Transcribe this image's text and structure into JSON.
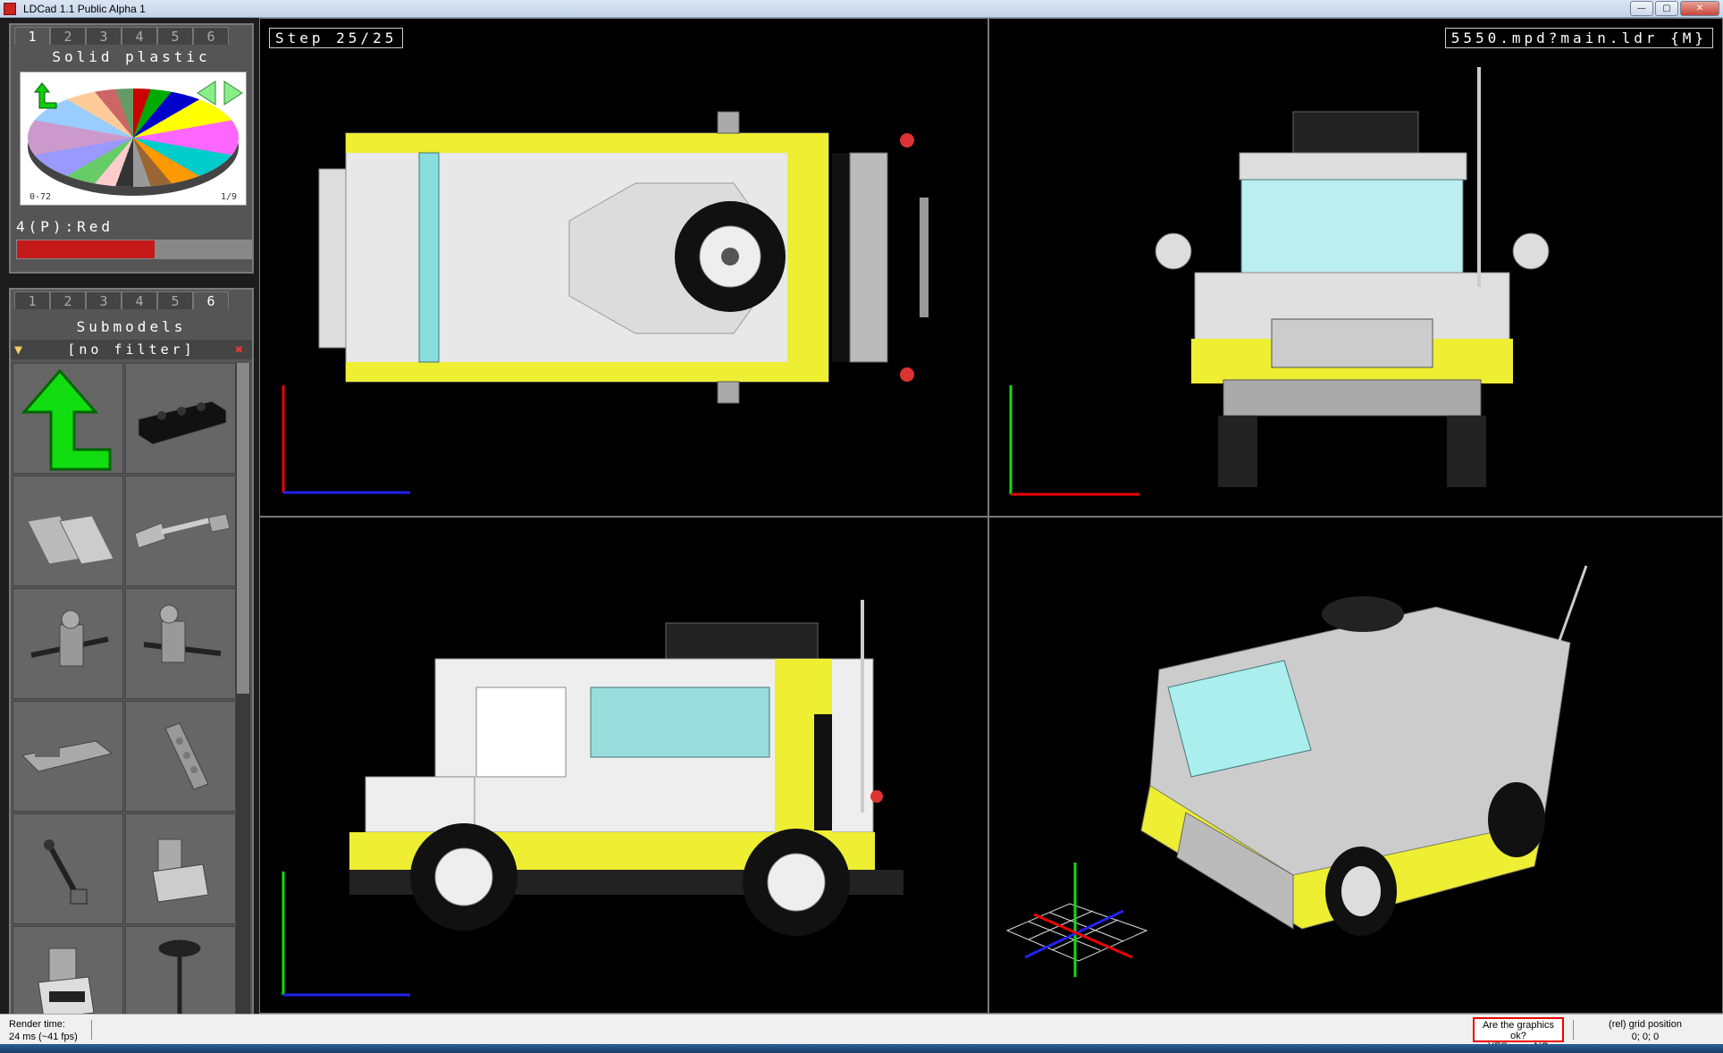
{
  "window": {
    "title": "LDCad 1.1 Public Alpha 1"
  },
  "colors": {
    "accent_red": "#ee0000",
    "panel_bg": "#555555",
    "viewport_bg": "#000000"
  },
  "palette_panel": {
    "tabs": [
      "1",
      "2",
      "3",
      "4",
      "5",
      "6"
    ],
    "active_tab": "1",
    "title": "Solid plastic",
    "range_label": "0-72",
    "page_label": "1/9",
    "current_color": "4(P):Red"
  },
  "submodels_panel": {
    "tabs": [
      "1",
      "2",
      "3",
      "4",
      "5",
      "6"
    ],
    "active_tab": "6",
    "title": "Submodels",
    "filter": "[no filter]",
    "items": [
      {
        "icon": "up-arrow-icon"
      },
      {
        "icon": "black-brick-icon"
      },
      {
        "icon": "plate-pair-icon"
      },
      {
        "icon": "bar-clip-icon"
      },
      {
        "icon": "axle-assembly-icon"
      },
      {
        "icon": "axle-joint-icon"
      },
      {
        "icon": "chassis-part-icon"
      },
      {
        "icon": "long-brick-icon"
      },
      {
        "icon": "steering-rod-icon"
      },
      {
        "icon": "seat-assembly-icon"
      },
      {
        "icon": "engine-block-icon"
      },
      {
        "icon": "wheel-stand-icon"
      }
    ]
  },
  "viewports": {
    "top_left": {
      "hud": "Step 25/25",
      "view": "top"
    },
    "top_right": {
      "hud": "5550.mpd?main.ldr {M}",
      "view": "front"
    },
    "bottom_left": {
      "view": "side"
    },
    "bottom_right": {
      "view": "3d"
    }
  },
  "status": {
    "render_label": "Render time:",
    "render_value": "24 ms (~41 fps)",
    "graphics_question": "Are the graphics ok?",
    "yes": "YES",
    "no": "NO",
    "grid_label": "(rel) grid position",
    "grid_value": "0; 0; 0"
  }
}
